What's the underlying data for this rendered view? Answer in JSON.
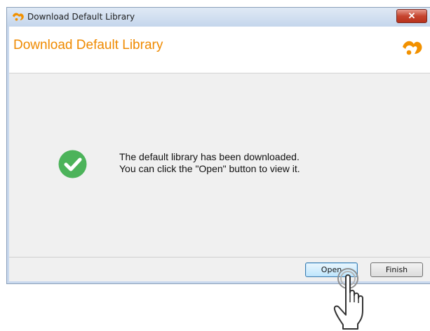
{
  "window": {
    "title": "Download Default Library",
    "close_label": "✕"
  },
  "header": {
    "title": "Download Default Library"
  },
  "message": {
    "line1": "The default library has been downloaded.",
    "line2": "You can click the \"Open\" button to view it."
  },
  "buttons": {
    "open_label": "Open",
    "finish_label": "Finish"
  },
  "icons": {
    "app": "app-logo-icon",
    "success": "check-circle-icon",
    "cursor": "hand-pointer-icon"
  },
  "colors": {
    "accent": "#ef8a00",
    "success": "#4cb35a",
    "close": "#c6452f"
  }
}
